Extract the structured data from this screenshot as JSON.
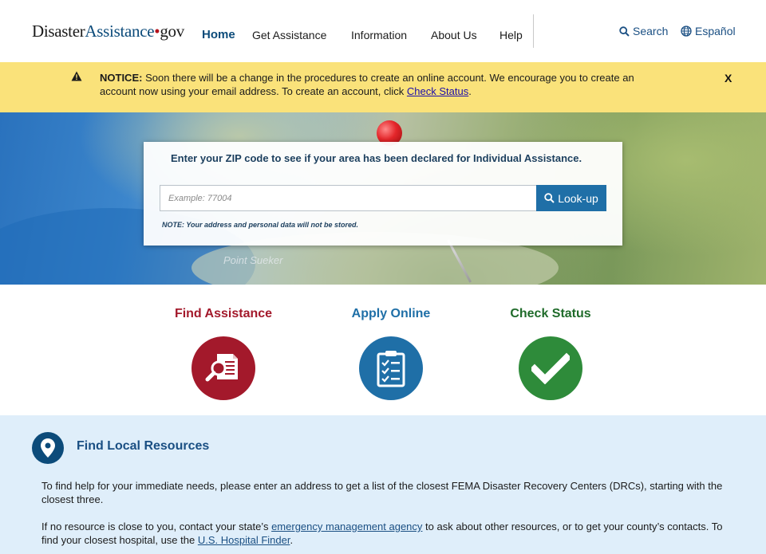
{
  "header": {
    "logo_part1": "Disaster",
    "logo_part2": "Assistance",
    "logo_dot": "•",
    "logo_part3": "gov",
    "nav": [
      {
        "label": "Home",
        "active": true
      },
      {
        "label": "Get Assistance"
      },
      {
        "label": "Information"
      },
      {
        "label": "About Us"
      },
      {
        "label": "Help"
      }
    ],
    "search_label": "Search",
    "language_label": "Español"
  },
  "notice": {
    "label": "NOTICE:",
    "text": " Soon there will be a change in the procedures to create an online account. We encourage you to create an account now using your email address. To create an account, click ",
    "link": "Check Status",
    "end": ".",
    "close": "X"
  },
  "hero": {
    "map_label": "Point Sueker",
    "prompt": "Enter your ZIP code to see if your area has been declared for Individual Assistance.",
    "zip_placeholder": "Example: 77004",
    "lookup_label": "Look-up",
    "note": "NOTE: Your address and personal data will not be stored."
  },
  "actions": [
    {
      "title": "Find Assistance",
      "color": "#a3192b",
      "icon": "document-search-icon"
    },
    {
      "title": "Apply Online",
      "color": "#1f6fa7",
      "icon": "checklist-icon"
    },
    {
      "title": "Check Status",
      "color": "#2e8b3a",
      "icon": "checkmark-icon"
    }
  ],
  "local": {
    "title": "Find Local Resources",
    "p1": "To find help for your immediate needs, please enter an address to get a list of the closest FEMA Disaster Recovery Centers (DRCs), starting with the closest three.",
    "p2_start": "If no resource is close to you, contact your state’s ",
    "p2_link1": "emergency management agency",
    "p2_mid": " to ask about other resources, or to get your county’s contacts. To find your closest hospital, use the ",
    "p2_link2": "U.S. Hospital Finder",
    "p2_end": "."
  },
  "colors": {
    "brand_blue": "#0c4b7a",
    "notice_yellow": "#fae27a",
    "find_red": "#a3192b",
    "apply_blue": "#1f6fa7",
    "status_green": "#2e8b3a",
    "local_bg": "#dfeefa"
  }
}
